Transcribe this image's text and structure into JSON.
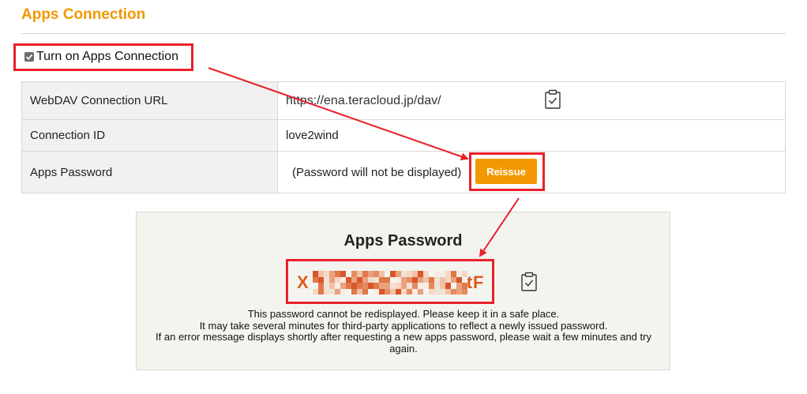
{
  "heading": "Apps Connection",
  "toggle": {
    "label": "Turn on Apps Connection",
    "checked": true
  },
  "settings": {
    "rows": [
      {
        "label": "WebDAV Connection URL",
        "value": "https://ena.teracloud.jp/dav/",
        "copy_icon": "clipboard-check-icon"
      },
      {
        "label": "Connection ID",
        "value": "love2wind"
      },
      {
        "label": "Apps Password",
        "value": "(Password will not be displayed)",
        "button": "Reissue"
      }
    ]
  },
  "panel": {
    "title": "Apps Password",
    "password_start": "X",
    "password_end": "tF",
    "copy_icon": "clipboard-check-icon",
    "notes": [
      "This password cannot be redisplayed. Please keep it in a safe place.",
      "It may take several minutes for third-party applications to reflect a newly issued password.",
      "If an error message displays shortly after requesting a new apps password, please wait a few minutes and try again."
    ]
  },
  "colors": {
    "accent": "#f39800",
    "highlight": "#e8202a",
    "password": "#e05a1a"
  }
}
